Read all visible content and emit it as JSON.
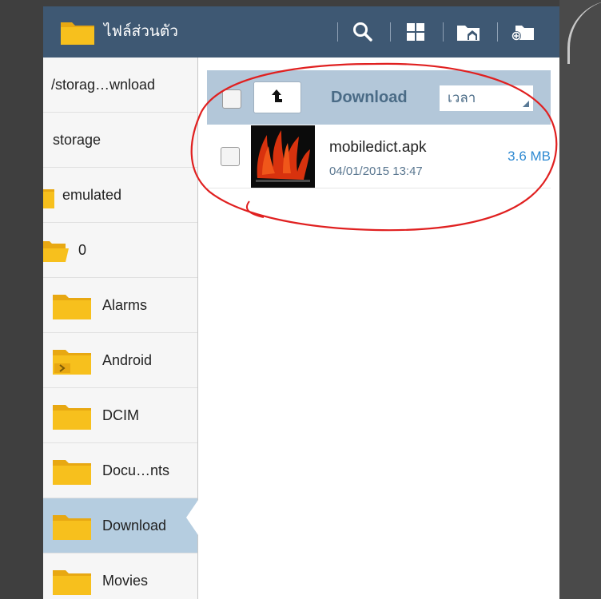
{
  "app": {
    "title": "ไฟล์ส่วนตัว"
  },
  "toolbar": {
    "icons": [
      "search-icon",
      "grid-view-icon",
      "home-folder-icon",
      "new-folder-icon"
    ]
  },
  "nav": {
    "items": [
      {
        "label": "/storag…wnload",
        "icon": "none"
      },
      {
        "label": "storage",
        "icon": "none"
      },
      {
        "label": "emulated",
        "icon": "folder-icon"
      },
      {
        "label": "0",
        "icon": "folder-open-icon"
      },
      {
        "label": "Alarms",
        "icon": "folder-icon"
      },
      {
        "label": "Android",
        "icon": "folder-arrow-icon"
      },
      {
        "label": "DCIM",
        "icon": "folder-icon"
      },
      {
        "label": "Docu…nts",
        "icon": "folder-icon"
      },
      {
        "label": "Download",
        "icon": "folder-icon",
        "selected": true
      },
      {
        "label": "Movies",
        "icon": "folder-icon"
      }
    ]
  },
  "content": {
    "folder_name": "Download",
    "sort": {
      "value": "เวลา"
    },
    "files": [
      {
        "name": "mobiledict.apk",
        "date": "04/01/2015 13:47",
        "size": "3.6 MB",
        "icon": "apk-thumbnail"
      }
    ]
  },
  "colors": {
    "actionbar": "#3e5873",
    "path_bar": "#b3c7d9",
    "selected_nav": "#b5cde0",
    "folder": "#f7c01d",
    "size_text": "#2f8ad2",
    "annotation": "#e02020"
  }
}
